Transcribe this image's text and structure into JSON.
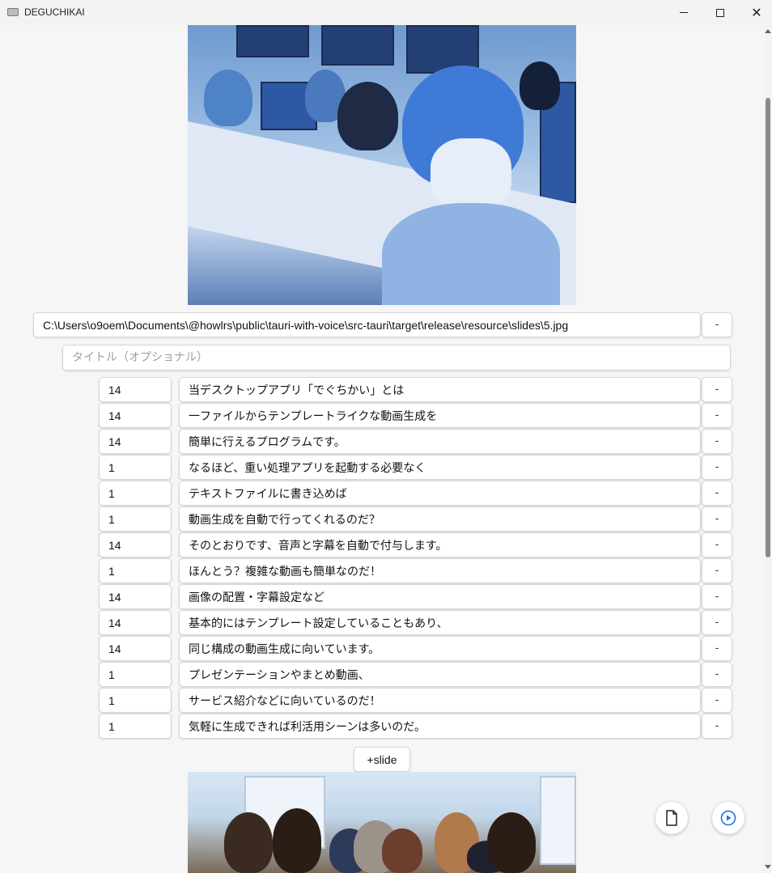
{
  "window": {
    "title": "DEGUCHIKAI"
  },
  "slide": {
    "image_path": "C:\\Users\\o9oem\\Documents\\@howlrs\\public\\tauri-with-voice\\src-tauri\\target\\release\\resource\\slides\\5.jpg",
    "title_placeholder": "タイトル（オプショナル）",
    "remove_label": "-",
    "lines": [
      {
        "speaker": "14",
        "text": "当デスクトップアプリ「でぐちかい」とは",
        "remove_label": "-"
      },
      {
        "speaker": "14",
        "text": "一ファイルからテンプレートライクな動画生成を",
        "remove_label": "-"
      },
      {
        "speaker": "14",
        "text": "簡単に行えるプログラムです。",
        "remove_label": "-"
      },
      {
        "speaker": "1",
        "text": "なるほど、重い処理アプリを起動する必要なく",
        "remove_label": "-"
      },
      {
        "speaker": "1",
        "text": "テキストファイルに書き込めば",
        "remove_label": "-"
      },
      {
        "speaker": "1",
        "text": "動画生成を自動で行ってくれるのだ？",
        "remove_label": "-"
      },
      {
        "speaker": "14",
        "text": "そのとおりです、音声と字幕を自動で付与します。",
        "remove_label": "-"
      },
      {
        "speaker": "1",
        "text": "ほんとう？複雑な動画も簡単なのだ！",
        "remove_label": "-"
      },
      {
        "speaker": "14",
        "text": "画像の配置・字幕設定など",
        "remove_label": "-"
      },
      {
        "speaker": "14",
        "text": "基本的にはテンプレート設定していることもあり、",
        "remove_label": "-"
      },
      {
        "speaker": "14",
        "text": "同じ構成の動画生成に向いています。",
        "remove_label": "-"
      },
      {
        "speaker": "1",
        "text": "プレゼンテーションやまとめ動画、",
        "remove_label": "-"
      },
      {
        "speaker": "1",
        "text": "サービス紹介などに向いているのだ！",
        "remove_label": "-"
      },
      {
        "speaker": "1",
        "text": "気軽に生成できれば利活用シーンは多いのだ。",
        "remove_label": "-"
      }
    ]
  },
  "add_slide_label": "+slide",
  "icons": {
    "file": "file-icon",
    "play": "play-circle-icon"
  },
  "colors": {
    "accent": "#1a73e8",
    "background": "#f6f6f6"
  }
}
